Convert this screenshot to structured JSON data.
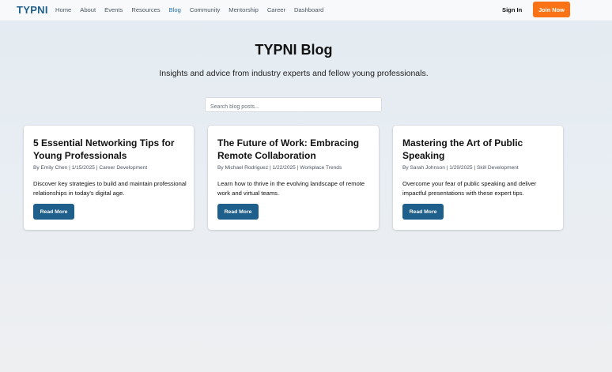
{
  "nav": {
    "logo": "TYPNI",
    "links": [
      {
        "label": "Home"
      },
      {
        "label": "About"
      },
      {
        "label": "Events"
      },
      {
        "label": "Resources"
      },
      {
        "label": "Blog",
        "active": true
      },
      {
        "label": "Community"
      },
      {
        "label": "Mentorship"
      },
      {
        "label": "Career"
      },
      {
        "label": "Dashboard"
      }
    ],
    "sign_in": "Sign In",
    "join_now": "Join Now"
  },
  "header": {
    "title": "TYPNI Blog",
    "subtitle": "Insights and advice from industry experts and fellow young professionals."
  },
  "search": {
    "placeholder": "Search blog posts...",
    "value": ""
  },
  "posts": [
    {
      "title": "5 Essential Networking Tips for Young Professionals",
      "meta": "By Emily Chen | 1/15/2025 | Career Development",
      "excerpt": "Discover key strategies to build and maintain professional relationships in today's digital age.",
      "button": "Read More"
    },
    {
      "title": "The Future of Work: Embracing Remote Collaboration",
      "meta": "By Michael Rodriguez | 1/22/2025 | Workplace Trends",
      "excerpt": "Learn how to thrive in the evolving landscape of remote work and virtual teams.",
      "button": "Read More"
    },
    {
      "title": "Mastering the Art of Public Speaking",
      "meta": "By Sarah Johnson | 1/29/2025 | Skill Development",
      "excerpt": "Overcome your fear of public speaking and deliver impactful presentations with these expert tips.",
      "button": "Read More"
    }
  ],
  "colors": {
    "brand": "#1f5f8c",
    "accent": "#f97316",
    "active_link": "#1f6fa8"
  }
}
